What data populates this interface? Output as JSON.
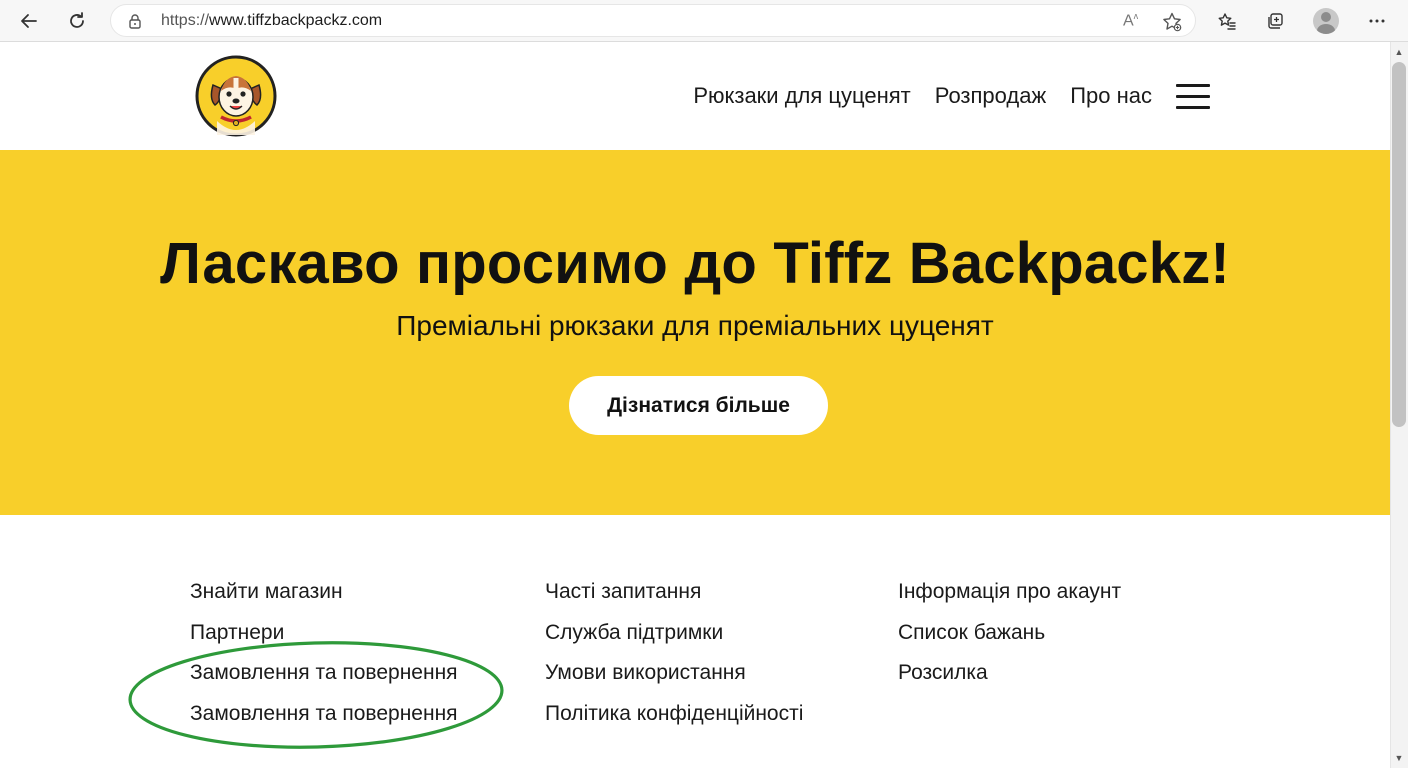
{
  "browser": {
    "url_scheme": "https://",
    "url_host": "www.tiffzbackpackz.com",
    "read_aloud_glyph": "Aͅ",
    "icons": [
      "back-arrow-icon",
      "refresh-icon",
      "lock-icon",
      "read-aloud-icon",
      "add-favorite-icon",
      "favorites-icon",
      "collections-icon",
      "profile-icon",
      "more-icon"
    ]
  },
  "header": {
    "nav": {
      "backpacks": "Рюкзаки для цуценят",
      "sale": "Розпродаж",
      "about": "Про нас"
    }
  },
  "hero": {
    "title": "Ласкаво просимо до Tiffz Backpackz!",
    "subtitle": "Преміальні рюкзаки для преміальних цуценят",
    "cta": "Дізнатися більше",
    "background_color": "#f8cf2a"
  },
  "footer": {
    "col1": [
      "Знайти магазин",
      "Партнери",
      "Замовлення та повернення",
      "Замовлення та повернення"
    ],
    "col2": [
      "Часті запитання",
      "Служба підтримки",
      "Умови використання",
      "Політика конфіденційності"
    ],
    "col3": [
      "Інформація про акаунт",
      "Список бажань",
      "Розсилка"
    ]
  },
  "annotation": {
    "color": "#2e9a3a",
    "shape": "ellipse around duplicated footer links"
  }
}
